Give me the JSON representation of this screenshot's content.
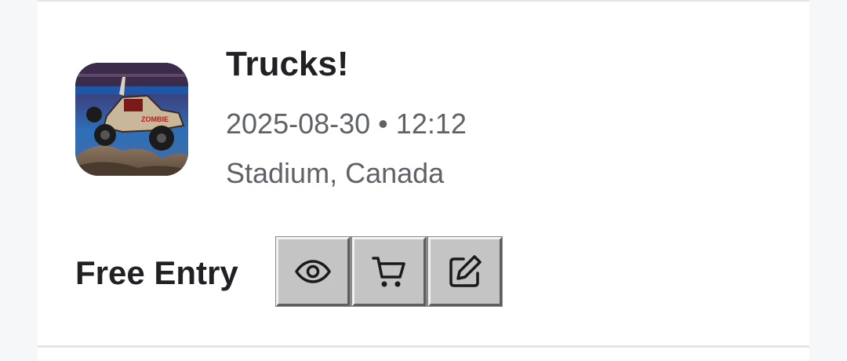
{
  "event": {
    "title": "Trucks!",
    "date": "2025-08-30",
    "separator": "•",
    "time": "12:12",
    "location": "Stadium, Canada",
    "price_label": "Free Entry",
    "thumbnail_alt": "Monster truck jumping over dirt mound in stadium",
    "thumbnail_truck_text": "ZOMBIE"
  },
  "actions": [
    {
      "name": "view-button",
      "icon": "eye-icon"
    },
    {
      "name": "cart-button",
      "icon": "cart-icon"
    },
    {
      "name": "edit-button",
      "icon": "edit-icon"
    }
  ],
  "colors": {
    "title": "#202124",
    "secondary_text": "#5f6368",
    "card_bg": "#ffffff",
    "page_bg": "#f6f7f8",
    "button_face": "#c4c4c4"
  }
}
